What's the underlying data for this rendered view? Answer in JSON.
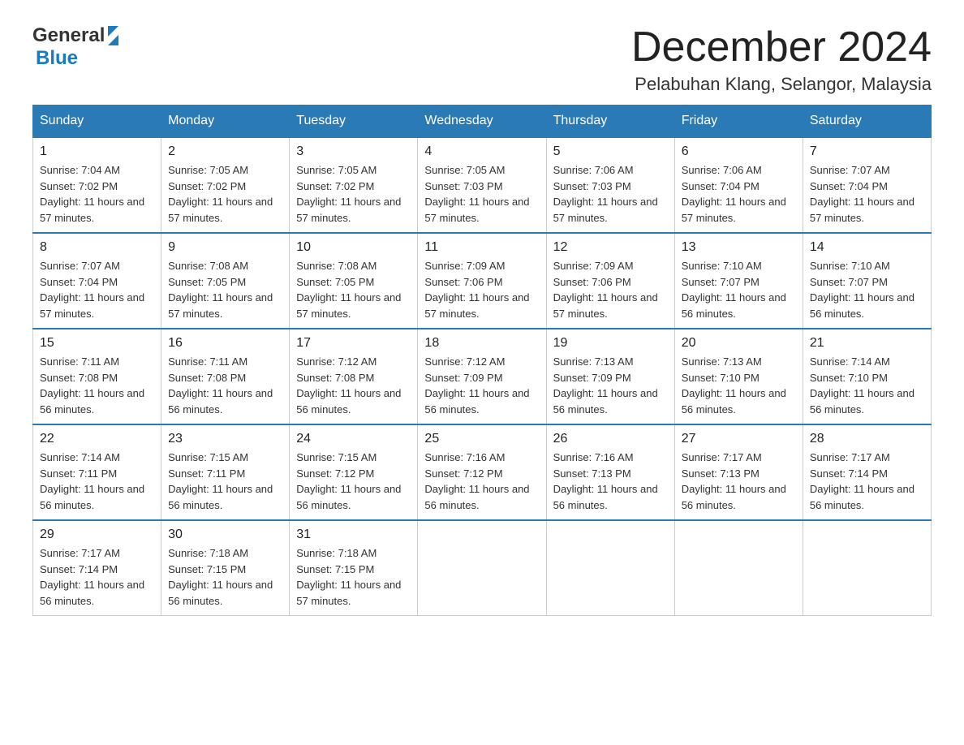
{
  "header": {
    "logo_general": "General",
    "logo_blue": "Blue",
    "month_title": "December 2024",
    "location": "Pelabuhan Klang, Selangor, Malaysia"
  },
  "weekdays": [
    "Sunday",
    "Monday",
    "Tuesday",
    "Wednesday",
    "Thursday",
    "Friday",
    "Saturday"
  ],
  "weeks": [
    [
      {
        "day": "1",
        "sunrise": "7:04 AM",
        "sunset": "7:02 PM",
        "daylight": "11 hours and 57 minutes."
      },
      {
        "day": "2",
        "sunrise": "7:05 AM",
        "sunset": "7:02 PM",
        "daylight": "11 hours and 57 minutes."
      },
      {
        "day": "3",
        "sunrise": "7:05 AM",
        "sunset": "7:02 PM",
        "daylight": "11 hours and 57 minutes."
      },
      {
        "day": "4",
        "sunrise": "7:05 AM",
        "sunset": "7:03 PM",
        "daylight": "11 hours and 57 minutes."
      },
      {
        "day": "5",
        "sunrise": "7:06 AM",
        "sunset": "7:03 PM",
        "daylight": "11 hours and 57 minutes."
      },
      {
        "day": "6",
        "sunrise": "7:06 AM",
        "sunset": "7:04 PM",
        "daylight": "11 hours and 57 minutes."
      },
      {
        "day": "7",
        "sunrise": "7:07 AM",
        "sunset": "7:04 PM",
        "daylight": "11 hours and 57 minutes."
      }
    ],
    [
      {
        "day": "8",
        "sunrise": "7:07 AM",
        "sunset": "7:04 PM",
        "daylight": "11 hours and 57 minutes."
      },
      {
        "day": "9",
        "sunrise": "7:08 AM",
        "sunset": "7:05 PM",
        "daylight": "11 hours and 57 minutes."
      },
      {
        "day": "10",
        "sunrise": "7:08 AM",
        "sunset": "7:05 PM",
        "daylight": "11 hours and 57 minutes."
      },
      {
        "day": "11",
        "sunrise": "7:09 AM",
        "sunset": "7:06 PM",
        "daylight": "11 hours and 57 minutes."
      },
      {
        "day": "12",
        "sunrise": "7:09 AM",
        "sunset": "7:06 PM",
        "daylight": "11 hours and 57 minutes."
      },
      {
        "day": "13",
        "sunrise": "7:10 AM",
        "sunset": "7:07 PM",
        "daylight": "11 hours and 56 minutes."
      },
      {
        "day": "14",
        "sunrise": "7:10 AM",
        "sunset": "7:07 PM",
        "daylight": "11 hours and 56 minutes."
      }
    ],
    [
      {
        "day": "15",
        "sunrise": "7:11 AM",
        "sunset": "7:08 PM",
        "daylight": "11 hours and 56 minutes."
      },
      {
        "day": "16",
        "sunrise": "7:11 AM",
        "sunset": "7:08 PM",
        "daylight": "11 hours and 56 minutes."
      },
      {
        "day": "17",
        "sunrise": "7:12 AM",
        "sunset": "7:08 PM",
        "daylight": "11 hours and 56 minutes."
      },
      {
        "day": "18",
        "sunrise": "7:12 AM",
        "sunset": "7:09 PM",
        "daylight": "11 hours and 56 minutes."
      },
      {
        "day": "19",
        "sunrise": "7:13 AM",
        "sunset": "7:09 PM",
        "daylight": "11 hours and 56 minutes."
      },
      {
        "day": "20",
        "sunrise": "7:13 AM",
        "sunset": "7:10 PM",
        "daylight": "11 hours and 56 minutes."
      },
      {
        "day": "21",
        "sunrise": "7:14 AM",
        "sunset": "7:10 PM",
        "daylight": "11 hours and 56 minutes."
      }
    ],
    [
      {
        "day": "22",
        "sunrise": "7:14 AM",
        "sunset": "7:11 PM",
        "daylight": "11 hours and 56 minutes."
      },
      {
        "day": "23",
        "sunrise": "7:15 AM",
        "sunset": "7:11 PM",
        "daylight": "11 hours and 56 minutes."
      },
      {
        "day": "24",
        "sunrise": "7:15 AM",
        "sunset": "7:12 PM",
        "daylight": "11 hours and 56 minutes."
      },
      {
        "day": "25",
        "sunrise": "7:16 AM",
        "sunset": "7:12 PM",
        "daylight": "11 hours and 56 minutes."
      },
      {
        "day": "26",
        "sunrise": "7:16 AM",
        "sunset": "7:13 PM",
        "daylight": "11 hours and 56 minutes."
      },
      {
        "day": "27",
        "sunrise": "7:17 AM",
        "sunset": "7:13 PM",
        "daylight": "11 hours and 56 minutes."
      },
      {
        "day": "28",
        "sunrise": "7:17 AM",
        "sunset": "7:14 PM",
        "daylight": "11 hours and 56 minutes."
      }
    ],
    [
      {
        "day": "29",
        "sunrise": "7:17 AM",
        "sunset": "7:14 PM",
        "daylight": "11 hours and 56 minutes."
      },
      {
        "day": "30",
        "sunrise": "7:18 AM",
        "sunset": "7:15 PM",
        "daylight": "11 hours and 56 minutes."
      },
      {
        "day": "31",
        "sunrise": "7:18 AM",
        "sunset": "7:15 PM",
        "daylight": "11 hours and 57 minutes."
      },
      null,
      null,
      null,
      null
    ]
  ]
}
